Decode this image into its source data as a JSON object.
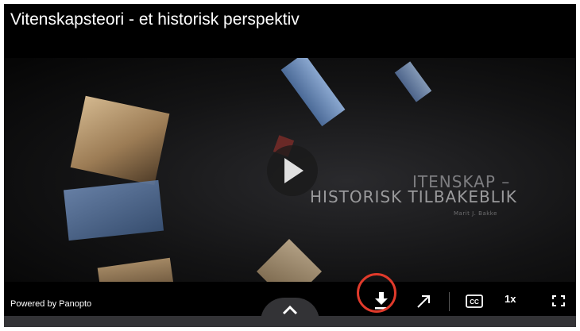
{
  "player": {
    "title": "Vitenskapsteori - et historisk perspektiv",
    "slide_text_line1": "ITENSKAP –",
    "slide_text_line2": "HISTORISK TILBAKEBLIK",
    "slide_author": "Marit J. Bakke"
  },
  "controls": {
    "powered_by": "Powered by Panopto",
    "download_icon": "download-icon",
    "share_icon": "open-external-icon",
    "cc_label": "CC",
    "speed_label": "1x",
    "fullscreen_icon": "fullscreen-icon",
    "toggle_icon": "chevron-up-icon",
    "highlight_color": "#e03a2b"
  }
}
